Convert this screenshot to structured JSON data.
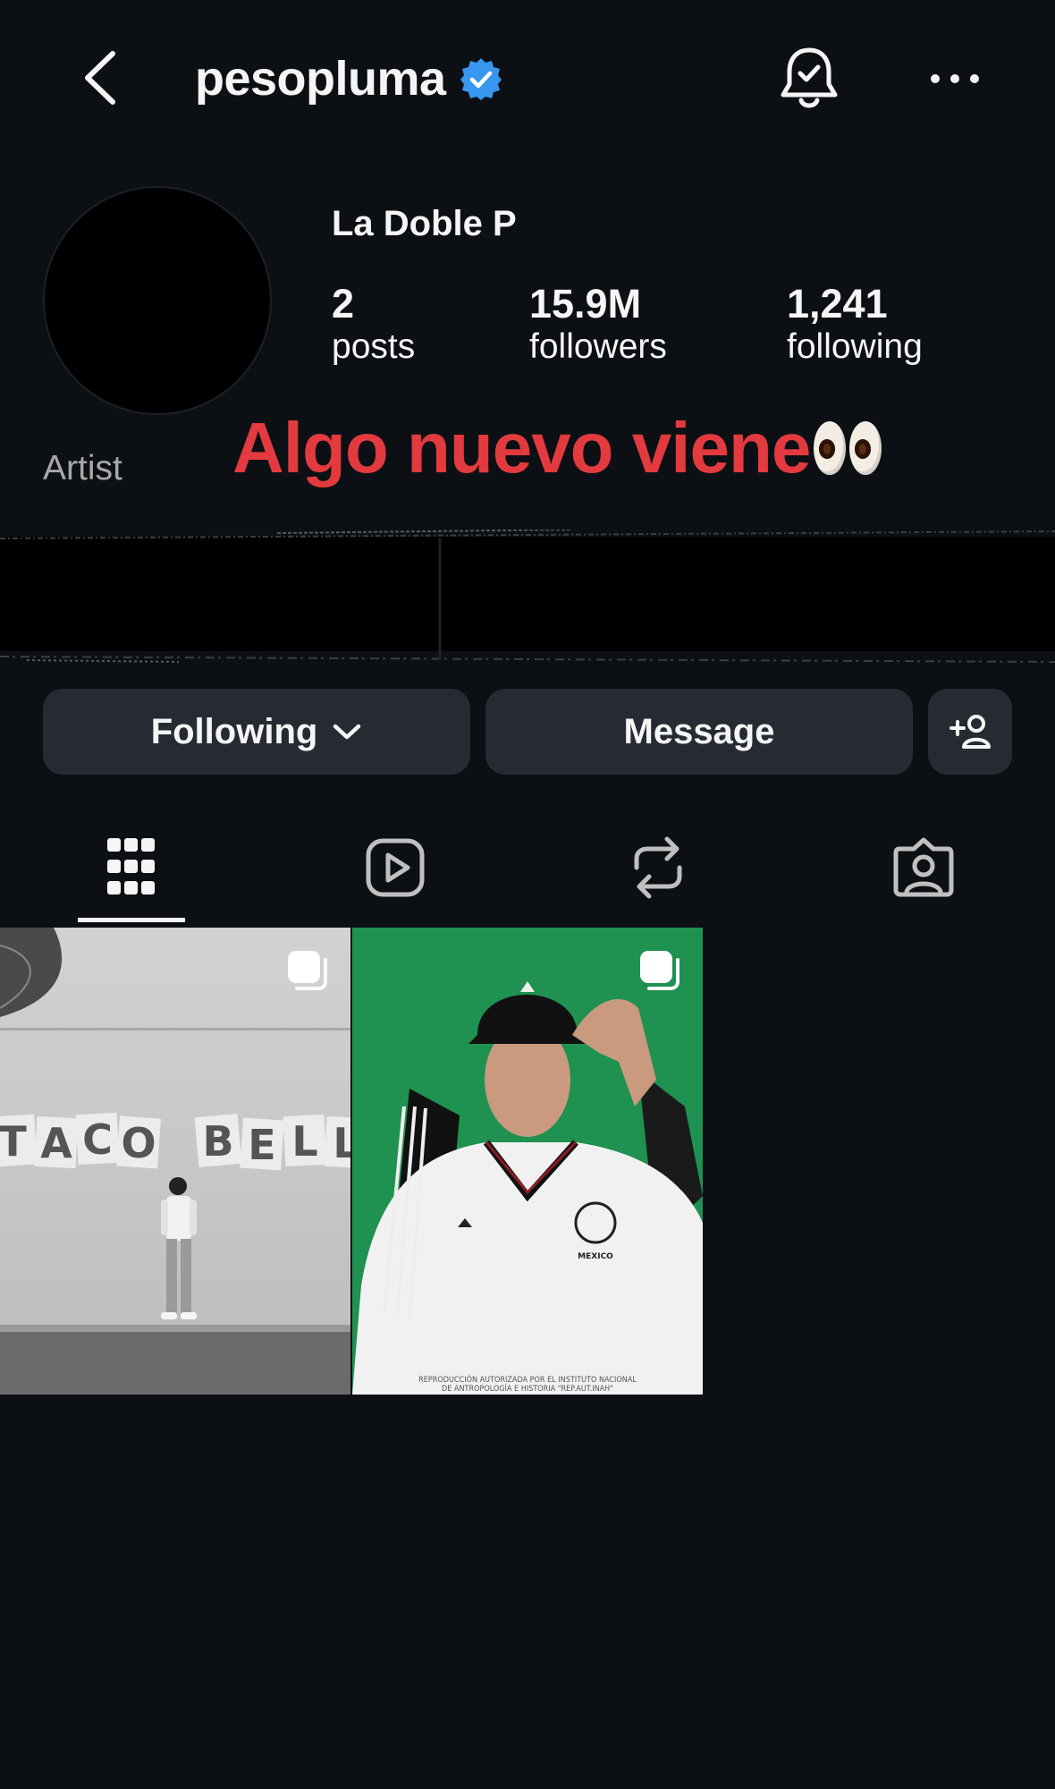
{
  "header": {
    "username": "pesopluma",
    "verified": true,
    "icons": [
      "back-arrow-icon",
      "verified-badge-icon",
      "notification-bell-icon",
      "more-options-icon"
    ]
  },
  "profile": {
    "display_name": "La Doble P",
    "category": "Artist",
    "stats": [
      {
        "value": "2",
        "label": "posts"
      },
      {
        "value": "15.9M",
        "label": "followers"
      },
      {
        "value": "1,241",
        "label": "following"
      }
    ],
    "overlay_caption": "Algo nuevo viene"
  },
  "actions": {
    "following_label": "Following",
    "message_label": "Message"
  },
  "tabs": [
    {
      "name": "grid",
      "icon": "grid-icon",
      "active": true
    },
    {
      "name": "reels",
      "icon": "reels-icon",
      "active": false
    },
    {
      "name": "reposts",
      "icon": "repost-icon",
      "active": false
    },
    {
      "name": "tagged",
      "icon": "tagged-icon",
      "active": false
    }
  ],
  "posts": [
    {
      "type": "carousel",
      "sign_text": "TACO BELL"
    },
    {
      "type": "carousel",
      "cap_text": "MEXICO",
      "caption_lines": [
        "REPRODUCCIÓN AUTORIZADA POR EL INSTITUTO NACIONAL",
        "DE ANTROPOLOGÍA E HISTORIA \"REP.AUT.INAH\""
      ]
    }
  ],
  "colors": {
    "background": "#0c1014",
    "button": "#262b33",
    "verified": "#3797f0",
    "overlay_text": "#e23a3e",
    "post2_background": "#1f9150"
  }
}
